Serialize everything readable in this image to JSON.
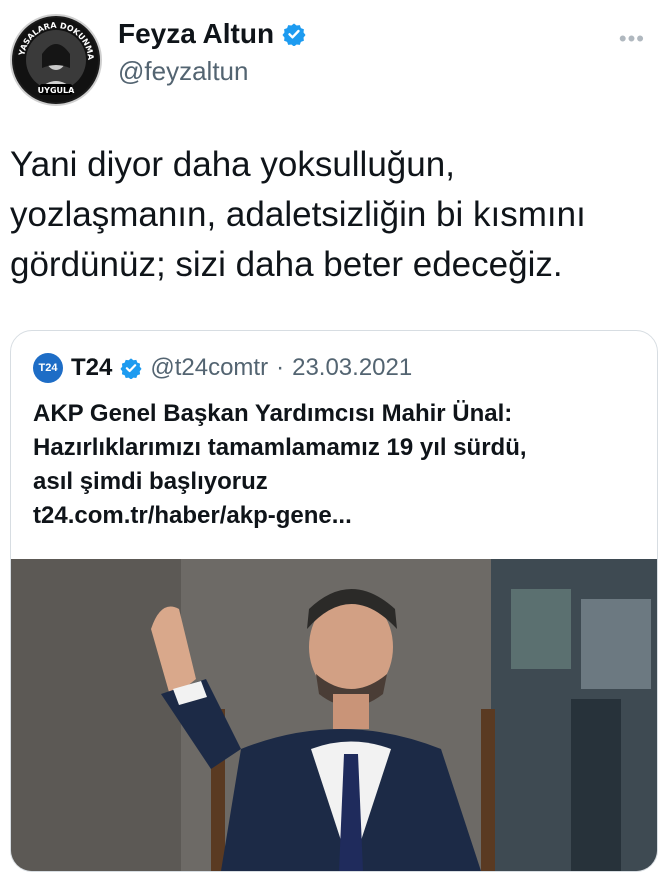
{
  "author": {
    "display_name": "Feyza Altun",
    "handle": "@feyzaltun",
    "avatar_text_top": "YASALARA DOKUNMA",
    "avatar_text_bottom": "UYGULA"
  },
  "tweet": {
    "text_lines": [
      "Yani diyor daha yoksulluğun,",
      "yozlaşmanın, adaletsizliğin bi kısmını",
      "gördünüz; sizi daha beter edeceğiz."
    ]
  },
  "quote": {
    "logo": "T24",
    "name": "T24",
    "handle": "@t24comtr",
    "separator": "·",
    "date": "23.03.2021",
    "headline_lines": [
      "AKP Genel Başkan Yardımcısı Mahir Ünal:",
      "Hazırlıklarımızı tamamlamamız 19 yıl sürdü,",
      "asıl şimdi başlıyoruz"
    ],
    "link": "t24.com.tr/haber/akp-gene..."
  },
  "colors": {
    "verified": "#1d9bf0",
    "text": "#0f1419",
    "secondary": "#536471",
    "t24_logo": "#1e6dc6"
  },
  "icons": {
    "verified": "verified-badge-icon",
    "more": "more-options-icon"
  }
}
